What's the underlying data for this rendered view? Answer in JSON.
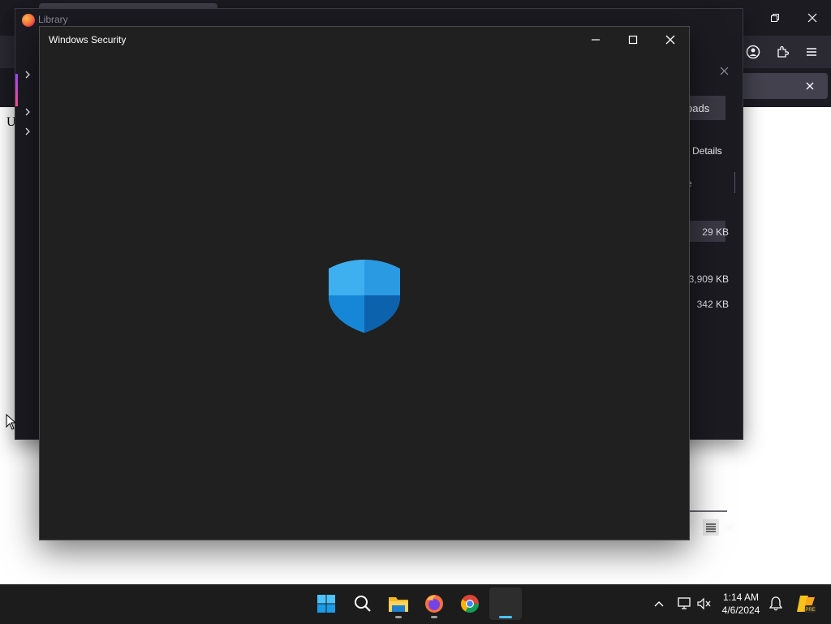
{
  "browser": {
    "page_text_fragment": "U",
    "window_controls": {
      "minimize": "—",
      "restore": "❐",
      "close": "✕"
    },
    "toolbar_icons": [
      "pocket-icon",
      "download-icon",
      "account-icon",
      "extensions-icon",
      "menu-icon"
    ]
  },
  "library": {
    "title": "Library",
    "tab_partial": "oads",
    "details_label": "Details",
    "header_partial": "e",
    "rows": [
      {
        "size": "29 KB"
      },
      {
        "size": "3,909 KB"
      },
      {
        "size": "342 KB"
      }
    ]
  },
  "windows_security": {
    "title": "Windows Security",
    "shield_colors": {
      "light": "#45b3ee",
      "mid": "#1b8ad8",
      "dark": "#0b5fa8"
    }
  },
  "taskbar": {
    "apps": [
      "windows-start",
      "search",
      "file-explorer",
      "firefox",
      "chrome",
      "windows-security"
    ],
    "time": "1:14 AM",
    "date": "4/6/2024"
  }
}
